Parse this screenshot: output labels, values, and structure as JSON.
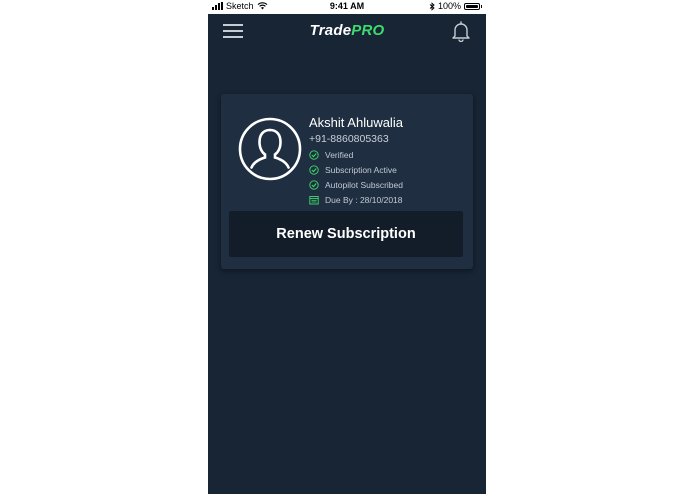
{
  "status_bar": {
    "carrier": "Sketch",
    "time": "9:41 AM",
    "battery": "100%"
  },
  "header": {
    "brand_part1": "Trade",
    "brand_part2": "PRO",
    "menu_icon": "hamburger-menu-icon",
    "notification_icon": "bell-icon"
  },
  "profile": {
    "avatar_icon": "user-avatar-icon",
    "name": "Akshit Ahluwalia",
    "phone": "+91-8860805363",
    "statuses": [
      {
        "label": "Verified",
        "icon": "check-icon"
      },
      {
        "label": "Subscription Active",
        "icon": "check-icon"
      },
      {
        "label": "Autopilot Subscribed",
        "icon": "check-icon"
      }
    ],
    "due": {
      "label": "Due By : 28/10/2018",
      "icon": "calendar-icon"
    }
  },
  "actions": {
    "renew_label": "Renew Subscription"
  },
  "colors": {
    "background": "#172535",
    "card": "#1f2e41",
    "button": "#131d29",
    "accent_green": "#3ddc6c"
  }
}
